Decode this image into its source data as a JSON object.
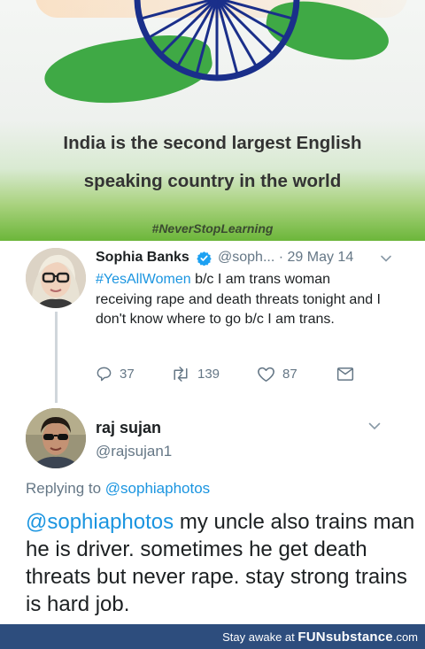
{
  "banner": {
    "line1": "India is the second largest English",
    "line2": "speaking country in the world",
    "hashtag": "#NeverStopLearning"
  },
  "tweet": {
    "author_name": "Sophia Banks",
    "author_handle": "@soph...",
    "separator": "·",
    "date": "29 May 14",
    "hashtag": "#YesAllWomen",
    "text_rest": " b/c I am trans woman receiving rape and death threats tonight and I don't know where to go b/c I am trans.",
    "replies": "37",
    "retweets": "139",
    "likes": "87"
  },
  "reply": {
    "author_name": "raj sujan",
    "author_handle": "@rajsujan1",
    "replying_prefix": "Replying to ",
    "replying_to": "@sophiaphotos",
    "mention": "@sophiaphotos",
    "text_rest": " my uncle also trains man he is driver. sometimes he get death threats but never rape. stay strong trains is hard job."
  },
  "footer": {
    "prefix": "Stay awake at ",
    "brand_bold": "FUN",
    "brand_rest": "substance",
    "suffix": ".com"
  },
  "colors": {
    "link_blue": "#1b95e0",
    "muted_gray": "#657786",
    "footer_bg": "#2d4d7d",
    "flag_green": "#3fa945"
  },
  "icons": [
    "ashoka-chakra-icon",
    "verified-badge-icon",
    "chevron-down-icon",
    "reply-icon",
    "retweet-icon",
    "like-heart-icon",
    "direct-message-icon"
  ]
}
